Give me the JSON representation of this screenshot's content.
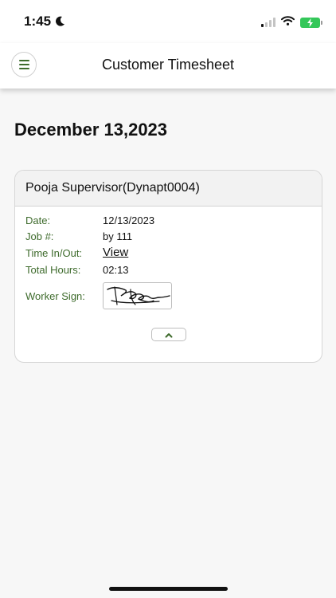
{
  "status_bar": {
    "time": "1:45",
    "icons": [
      "moon-icon",
      "signal-icon",
      "wifi-icon",
      "battery-charging-icon"
    ]
  },
  "header": {
    "menu_icon": "hamburger-menu-icon",
    "title": "Customer Timesheet"
  },
  "date_heading": "December 13,2023",
  "card": {
    "title": "Pooja Supervisor(Dynapt0004)",
    "fields": {
      "date_label": "Date:",
      "date_value": "12/13/2023",
      "job_label": "Job #:",
      "job_value": "by 111",
      "time_label": "Time In/Out:",
      "time_link": "View",
      "hours_label": "Total Hours:",
      "hours_value": "02:13",
      "sign_label": "Worker Sign:"
    },
    "collapse_icon": "chevron-up-icon"
  },
  "colors": {
    "accent_green": "#3e6b2c",
    "battery_green": "#34c759",
    "background": "#f7f7f7"
  }
}
